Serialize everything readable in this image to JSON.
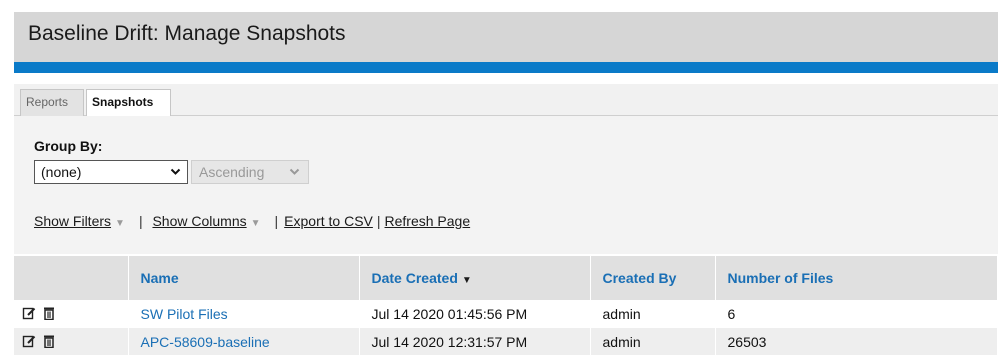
{
  "header": {
    "title": "Baseline Drift: Manage Snapshots"
  },
  "tabs": [
    {
      "label": "Reports",
      "active": false
    },
    {
      "label": "Snapshots",
      "active": true
    }
  ],
  "group_by": {
    "label": "Group By:",
    "value": "(none)",
    "order": "Ascending"
  },
  "actions": {
    "show_filters": "Show Filters",
    "show_columns": "Show Columns",
    "export_csv": "Export to CSV",
    "refresh": "Refresh Page"
  },
  "table": {
    "columns": [
      "",
      "Name",
      "Date Created",
      "Created By",
      "Number of Files"
    ],
    "sorted_column": "Date Created",
    "rows": [
      {
        "name": "SW Pilot Files",
        "date": "Jul 14 2020 01:45:56 PM",
        "created_by": "admin",
        "files": "6"
      },
      {
        "name": "APC-58609-baseline",
        "date": "Jul 14 2020 12:31:57 PM",
        "created_by": "admin",
        "files": "26503"
      }
    ]
  },
  "icons": {
    "edit": "edit-icon",
    "delete": "trash-icon",
    "select": "chevron-down-icon",
    "sort": "sort-desc-icon"
  },
  "colors": {
    "accent": "#0a7ac8",
    "link": "#1a6fb5",
    "header_bg": "#d6d6d6"
  }
}
